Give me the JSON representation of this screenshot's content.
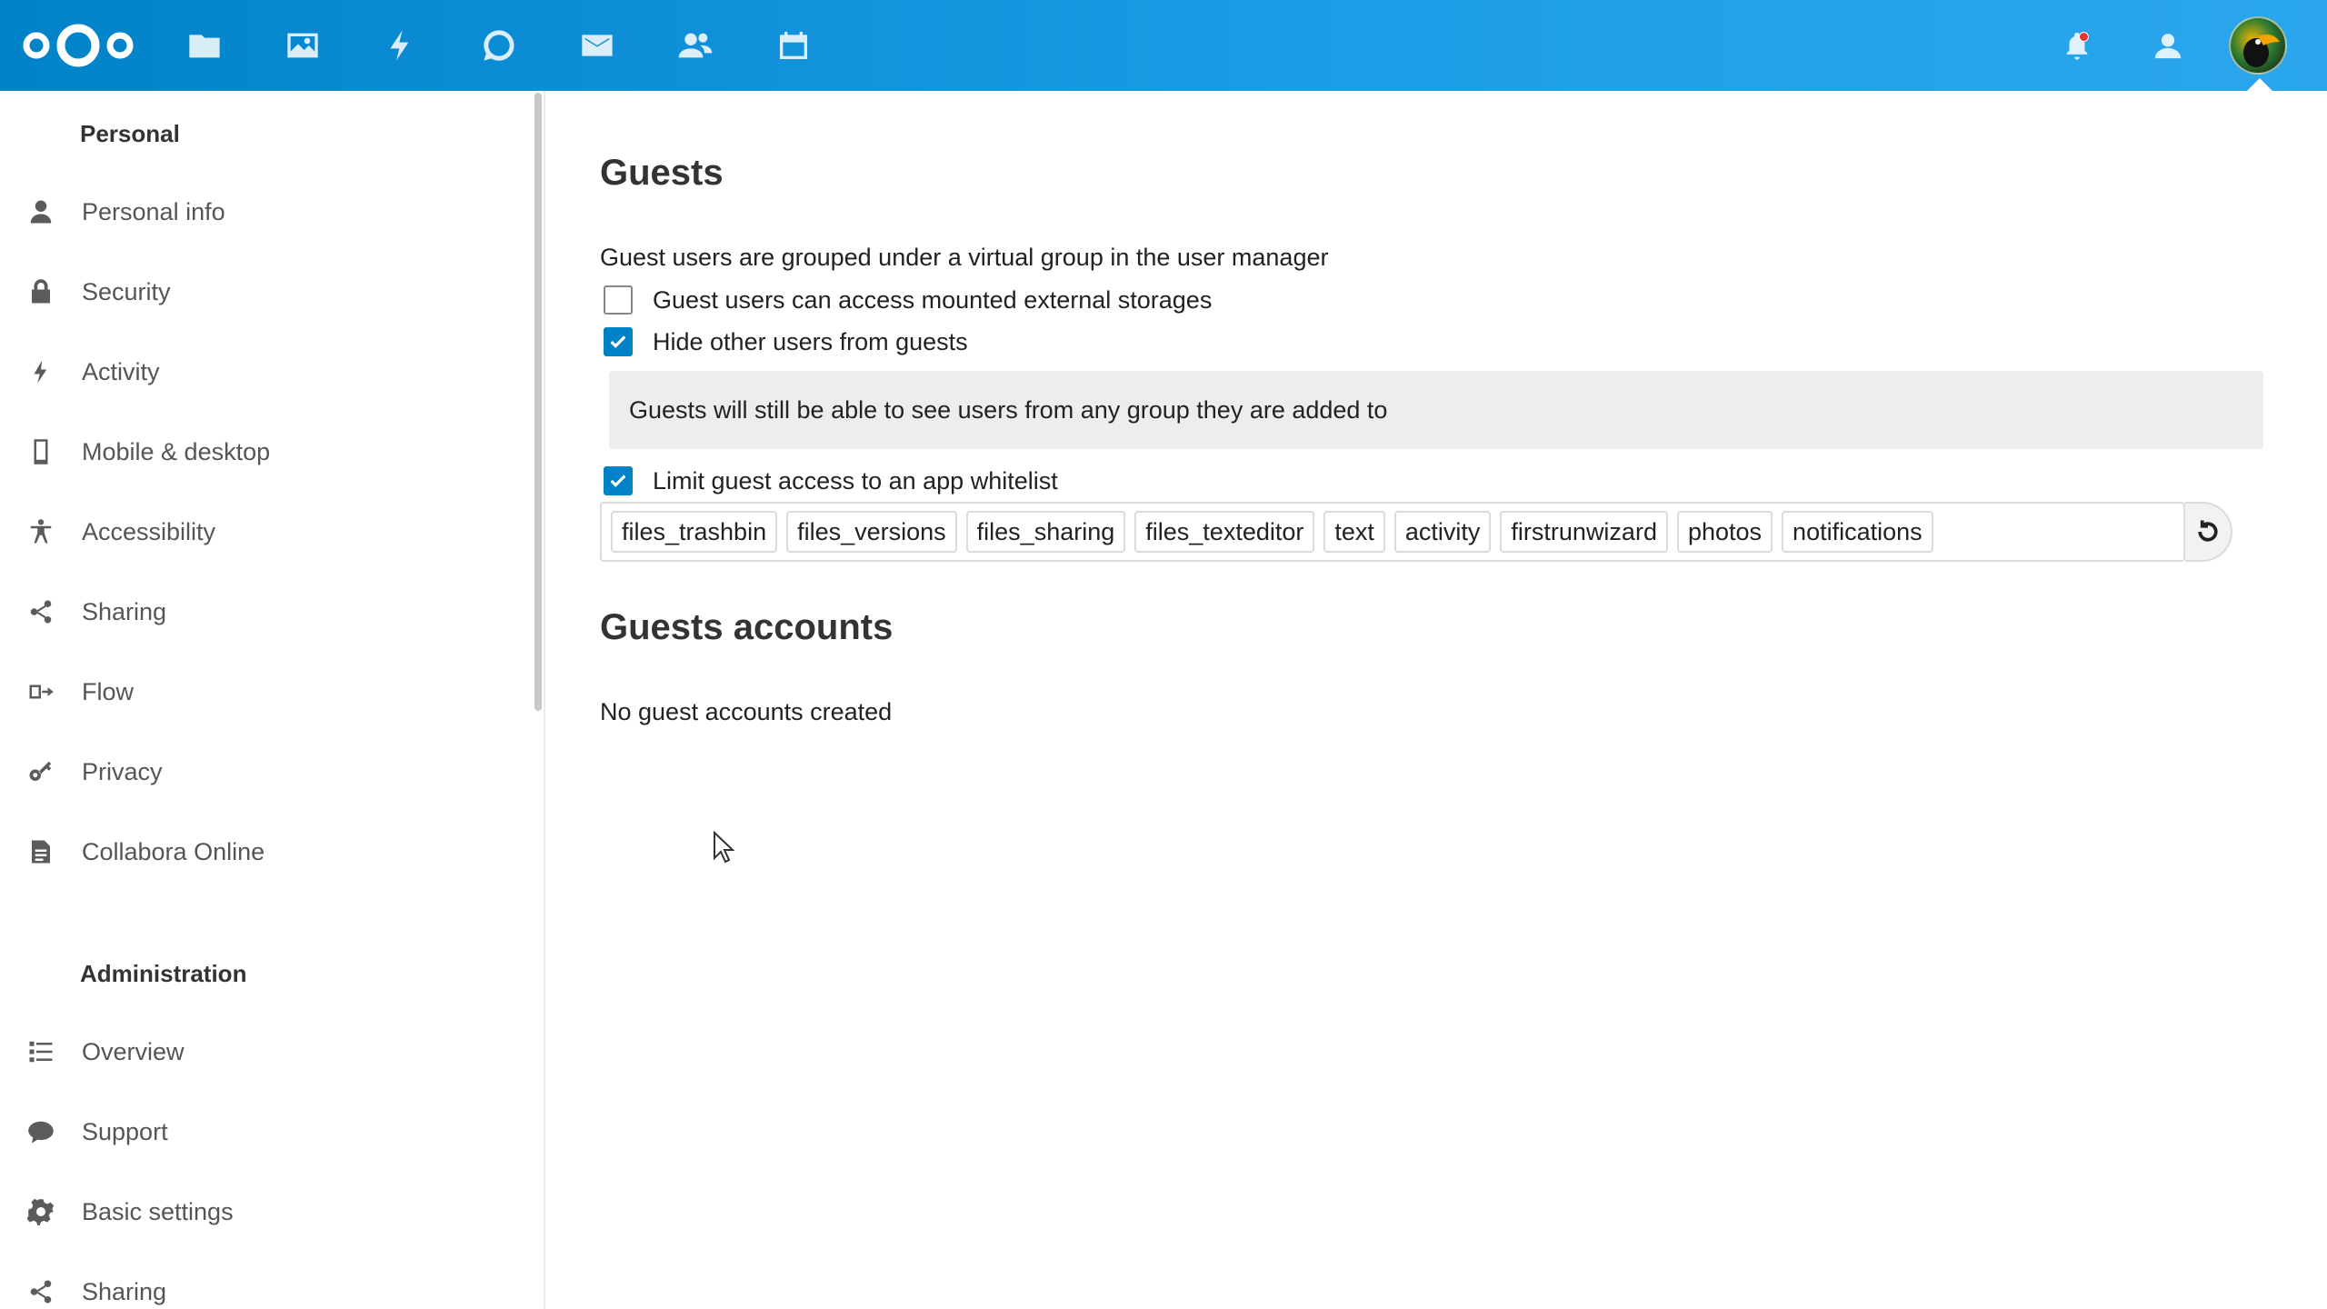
{
  "header": {
    "apps": [
      {
        "name": "files-icon"
      },
      {
        "name": "photos-icon"
      },
      {
        "name": "activity-icon"
      },
      {
        "name": "talk-icon"
      },
      {
        "name": "mail-icon"
      },
      {
        "name": "contacts-icon"
      },
      {
        "name": "calendar-icon"
      }
    ],
    "brand_color": "#0082c9"
  },
  "sidebar": {
    "personal_heading": "Personal",
    "personal_items": [
      {
        "label": "Personal info",
        "icon": "user-icon"
      },
      {
        "label": "Security",
        "icon": "lock-icon"
      },
      {
        "label": "Activity",
        "icon": "lightning-icon"
      },
      {
        "label": "Mobile & desktop",
        "icon": "phone-icon"
      },
      {
        "label": "Accessibility",
        "icon": "accessibility-icon"
      },
      {
        "label": "Sharing",
        "icon": "share-icon"
      },
      {
        "label": "Flow",
        "icon": "flow-icon"
      },
      {
        "label": "Privacy",
        "icon": "key-icon"
      },
      {
        "label": "Collabora Online",
        "icon": "document-icon"
      }
    ],
    "admin_heading": "Administration",
    "admin_items": [
      {
        "label": "Overview",
        "icon": "list-icon"
      },
      {
        "label": "Support",
        "icon": "chat-bubble-icon"
      },
      {
        "label": "Basic settings",
        "icon": "gear-icon"
      },
      {
        "label": "Sharing",
        "icon": "share-icon"
      }
    ]
  },
  "main": {
    "guests_title": "Guests",
    "description": "Guest users are grouped under a virtual group in the user manager",
    "options": [
      {
        "label": "Guest users can access mounted external storages",
        "checked": false
      },
      {
        "label": "Hide other users from guests",
        "checked": true
      },
      {
        "label": "Limit guest access to an app whitelist",
        "checked": true
      }
    ],
    "notice": "Guests will still be able to see users from any group they are added to",
    "whitelist": [
      "files_trashbin",
      "files_versions",
      "files_sharing",
      "files_texteditor",
      "text",
      "activity",
      "firstrunwizard",
      "photos",
      "notifications"
    ],
    "accounts_title": "Guests accounts",
    "accounts_empty": "No guest accounts created"
  }
}
